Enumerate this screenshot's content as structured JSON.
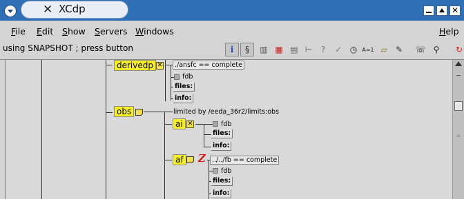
{
  "window": {
    "title": "XCdp"
  },
  "menu": {
    "file": "File",
    "edit": "Edit",
    "show": "Show",
    "servers": "Servers",
    "windows": "Windows",
    "help": "Help"
  },
  "toolbar": {
    "status": "using SNAPSHOT ; press button",
    "tools": [
      {
        "name": "info-icon",
        "glyph": "i",
        "color": "#1f3fbf"
      },
      {
        "name": "script-icon",
        "glyph": "§",
        "color": "#333333"
      },
      {
        "name": "books-icon",
        "glyph": "▥",
        "color": "#555555"
      },
      {
        "name": "colour-grid-icon",
        "glyph": "▦",
        "color": "#cc2222"
      },
      {
        "name": "table-icon",
        "glyph": "▤",
        "color": "#666666"
      },
      {
        "name": "tree-icon",
        "glyph": "⊢",
        "color": "#666666"
      },
      {
        "name": "help-icon",
        "glyph": "?",
        "color": "#777777"
      },
      {
        "name": "check-icon",
        "glyph": "✓",
        "color": "#777777"
      },
      {
        "name": "clock-icon",
        "glyph": "◷",
        "color": "#222222"
      },
      {
        "name": "a-equals-1-icon",
        "glyph": "A=1",
        "color": "#222222"
      },
      {
        "name": "note-icon",
        "glyph": "▱",
        "color": "#8a7a10"
      },
      {
        "name": "edit-note-icon",
        "glyph": "✎",
        "color": "#333333"
      },
      {
        "name": "phone-icon",
        "glyph": "☏",
        "color": "#222222"
      },
      {
        "name": "search-icon",
        "glyph": "⚲",
        "color": "#222222"
      },
      {
        "name": "refresh-icon",
        "glyph": "↻",
        "color": "#d42020"
      }
    ]
  },
  "tree": {
    "derivedp": {
      "label": "derivedp",
      "trigger": "./ansfc == complete",
      "var": "fdb",
      "files": "files:",
      "info": "info:"
    },
    "obs": {
      "label": "obs",
      "limit": "limited by /eeda_36r2/limits:obs"
    },
    "ai": {
      "label": "ai",
      "var": "fdb",
      "files": "files:",
      "info": "info:"
    },
    "af": {
      "label": "af",
      "trigger": "../../fb == complete",
      "var": "fdb",
      "files": "files:",
      "info": "info:"
    }
  },
  "colors": {
    "node_yellow": "#f7ef22",
    "titlebar_blue": "#2f6fb5",
    "z_red": "#d41818"
  }
}
